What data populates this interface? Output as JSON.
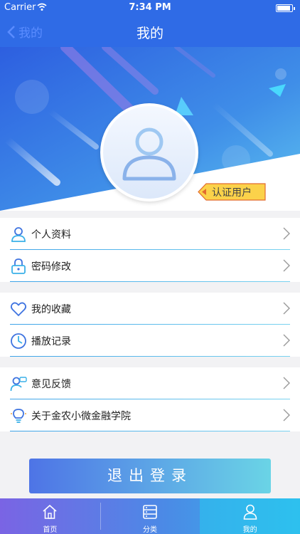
{
  "status_bar": {
    "carrier": "Carrier",
    "time": "7:34 PM"
  },
  "nav": {
    "back_label": "我的",
    "title": "我的"
  },
  "profile": {
    "badge": "认证用户"
  },
  "menu": {
    "group1": [
      {
        "label": "个人资料",
        "icon": "person-icon"
      },
      {
        "label": "密码修改",
        "icon": "lock-icon"
      }
    ],
    "group2": [
      {
        "label": "我的收藏",
        "icon": "heart-icon"
      },
      {
        "label": "播放记录",
        "icon": "clock-icon"
      }
    ],
    "group3": [
      {
        "label": "意见反馈",
        "icon": "feedback-icon"
      },
      {
        "label": "关于金农小微金融学院",
        "icon": "bulb-icon"
      }
    ]
  },
  "logout_label": "退出登录",
  "tabs": [
    {
      "label": "首页",
      "icon": "home-icon",
      "active": false
    },
    {
      "label": "分类",
      "icon": "list-icon",
      "active": false
    },
    {
      "label": "我的",
      "icon": "user-icon",
      "active": true
    }
  ],
  "colors": {
    "primary": "#2f6be6",
    "accent_line": "#3ea3e8",
    "badge": "#fbd24a"
  }
}
